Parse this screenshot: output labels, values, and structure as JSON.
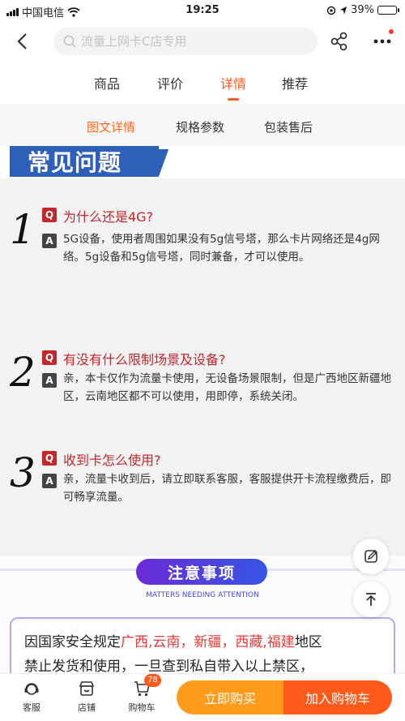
{
  "status_bar": {
    "carrier": "中国电信",
    "time": "19:25",
    "battery": "39%",
    "battery_level": 0.39
  },
  "nav": {
    "search_placeholder": "流量上网卡C店专用"
  },
  "tabs": [
    {
      "label": "商品",
      "active": false
    },
    {
      "label": "评价",
      "active": false
    },
    {
      "label": "详情",
      "active": true
    },
    {
      "label": "推荐",
      "active": false
    }
  ],
  "subtabs": [
    {
      "label": "图文详情",
      "active": true
    },
    {
      "label": "规格参数",
      "active": false
    },
    {
      "label": "包装售后",
      "active": false
    }
  ],
  "faq": {
    "title": "常见问题",
    "q_badge": "Q",
    "a_badge": "A",
    "items": [
      {
        "num": "1",
        "question": "为什么还是4G?",
        "answer": "5G设备，使用者周围如果没有5g信号塔，那么卡片网络还是4g网络。5g设备和5g信号塔，同时兼备，才可以使用。"
      },
      {
        "num": "2",
        "question": "有没有什么限制场景及设备?",
        "answer": "亲，本卡仅作为流量卡使用，无设备场景限制，但是广西地区新疆地区，云南地区都不可以使用，用即停，系统关闭。"
      },
      {
        "num": "3",
        "question": "收到卡怎么使用?",
        "answer": "亲，流量卡收到后，请立即联系客服，客服提供开卡流程缴费后，即可畅享流量。"
      }
    ]
  },
  "notice": {
    "title": "注意事项",
    "subtitle": "MATTERS NEEDING ATTENTION",
    "text_1": "因国家安全规定",
    "regions": "广西,云南，新疆，西藏,福建",
    "text_2": "地区",
    "text_3": "禁止发货和使用，一旦查到私自带入以上禁区，"
  },
  "bottom_bar": {
    "service": "客服",
    "store": "店铺",
    "cart": "购物车",
    "cart_count": "78",
    "buy_now": "立即购买",
    "add_cart": "加入购物车"
  },
  "colors": {
    "accent": "#ff5b1e",
    "faq_blue": "#2f60b9",
    "question_red": "#c2272d",
    "buy_now": "#ff9a1a",
    "add_cart": "#ff5a1a"
  },
  "icons": {
    "back": "chevron-left-icon",
    "search": "search-icon",
    "share": "share-icon",
    "more": "more-icon",
    "edit": "edit-icon",
    "top": "back-to-top-icon",
    "service": "headset-icon",
    "store": "store-icon",
    "cart": "cart-icon"
  }
}
